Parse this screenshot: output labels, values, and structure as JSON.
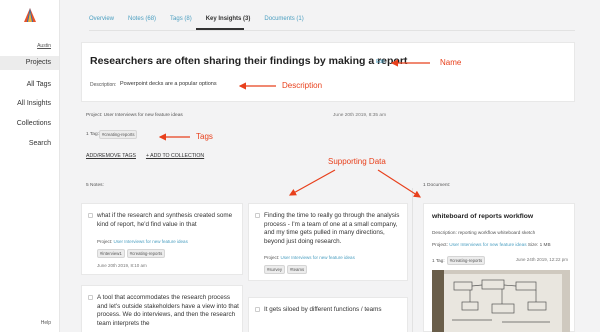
{
  "sidebar": {
    "user": "Austin",
    "items": [
      "Projects",
      "All Tags",
      "All Insights",
      "Collections",
      "Search"
    ],
    "help": "Help"
  },
  "tabs": [
    "Overview",
    "Notes (68)",
    "Tags (8)",
    "Key Insights (3)",
    "Documents (1)"
  ],
  "insight": {
    "title": "Researchers are often sharing their findings by making a report",
    "edit": "Edit",
    "description_label": "Description:",
    "description": "Powerpoint decks are a popular options"
  },
  "meta": {
    "project": "Project: User Interviews for new feature ideas",
    "date": "June 20th 2019, 8:35 am",
    "tag_label": "1 Tag:",
    "tag": "#creating-reports",
    "add_remove_tags": "ADD/REMOVE TAGS",
    "add_to_collection": "+ ADD TO COLLECTION"
  },
  "notes_count": "5 Notes:",
  "docs_count": "1 Document:",
  "notes": [
    {
      "text": "what if the research and synthesis created some kind of report, he'd find value in that",
      "project_prefix": "Project:",
      "project": "User Interviews for new feature ideas",
      "tags": [
        "#interview1",
        "#creating-reports"
      ],
      "date": "June 20th 2019, 8:10 am"
    },
    {
      "text": "Finding the time to really go through the analysis process - I'm a team of one at a small company, and my time gets pulled in many directions, beyond just doing research.",
      "project_prefix": "Project:",
      "project": "User Interviews for new feature ideas",
      "tags": [
        "#survey",
        "#teams"
      ],
      "date": ""
    },
    {
      "text": "A tool that accommodates the research process and let's outside stakeholders have a view into that process. We do interviews, and then the research team interprets the",
      "project_prefix": "",
      "project": "",
      "tags": [],
      "date": ""
    },
    {
      "text": "It gets siloed by different functions / teams",
      "project_prefix": "",
      "project": "",
      "tags": [],
      "date": ""
    }
  ],
  "document": {
    "title": "whiteboard of reports workflow",
    "description_label": "Description:",
    "description": "reporting workflow whiteboard sketch",
    "project_prefix": "Project:",
    "project": "User Interviews for new feature ideas",
    "size": "Size: 1 MB",
    "tag_label": "1 Tag:",
    "tag": "#creating-reports",
    "date": "June 24th 2019, 12:22 pm"
  },
  "annotations": {
    "name": "Name",
    "description": "Description",
    "tags": "Tags",
    "supporting_data": "Supporting Data"
  },
  "colors": {
    "accent_link": "#4a9ec0",
    "annotation_red": "#e8401c",
    "logo_orange": "#e8522b"
  }
}
